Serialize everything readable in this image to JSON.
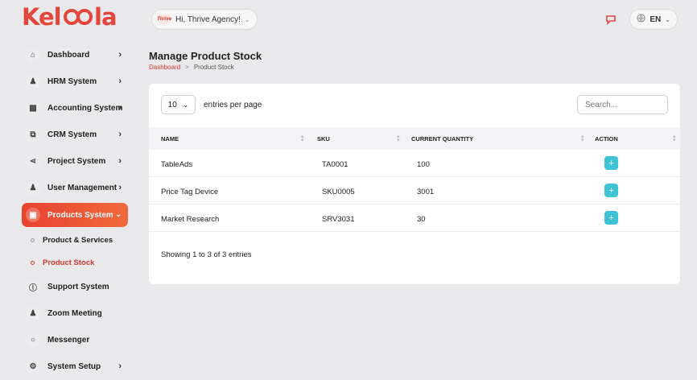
{
  "header": {
    "logo": "KELOOLA",
    "brand_badge": "Thrive",
    "greeting": "Hi, Thrive Agency!",
    "language": "EN"
  },
  "sidebar": {
    "items": [
      {
        "label": "Dashboard",
        "icon": "home-icon"
      },
      {
        "label": "HRM System",
        "icon": "user-icon"
      },
      {
        "label": "Accounting System",
        "icon": "box-icon"
      },
      {
        "label": "CRM System",
        "icon": "layers-icon"
      },
      {
        "label": "Project System",
        "icon": "share-icon"
      },
      {
        "label": "User Management",
        "icon": "users-icon"
      },
      {
        "label": "Products System",
        "icon": "cart-icon"
      }
    ],
    "subitems": [
      {
        "label": "Product & Services"
      },
      {
        "label": "Product Stock"
      }
    ],
    "items2": [
      {
        "label": "Support System",
        "icon": "headset-icon"
      },
      {
        "label": "Zoom Meeting",
        "icon": "user-video-icon"
      },
      {
        "label": "Messenger",
        "icon": "chat-icon"
      },
      {
        "label": "System Setup",
        "icon": "gear-icon"
      }
    ]
  },
  "page": {
    "title": "Manage Product Stock",
    "breadcrumb": {
      "home": "Dashboard",
      "sep": ">",
      "current": "Product Stock"
    }
  },
  "table": {
    "page_size": "10",
    "entries_label": "entries per page",
    "search_placeholder": "Search...",
    "columns": [
      "NAME",
      "SKU",
      "CURRENT QUANTITY",
      "ACTION"
    ],
    "rows": [
      {
        "name": "TableAds",
        "sku": "TA0001",
        "qty": "100"
      },
      {
        "name": "Price Tag Device",
        "sku": "SKU0005",
        "qty": "3001"
      },
      {
        "name": "Market Research",
        "sku": "SRV3031",
        "qty": "30"
      }
    ],
    "footer": "Showing 1 to 3 of 3 entries"
  },
  "colors": {
    "accent": "#e8422f",
    "action": "#3ec3d6"
  }
}
